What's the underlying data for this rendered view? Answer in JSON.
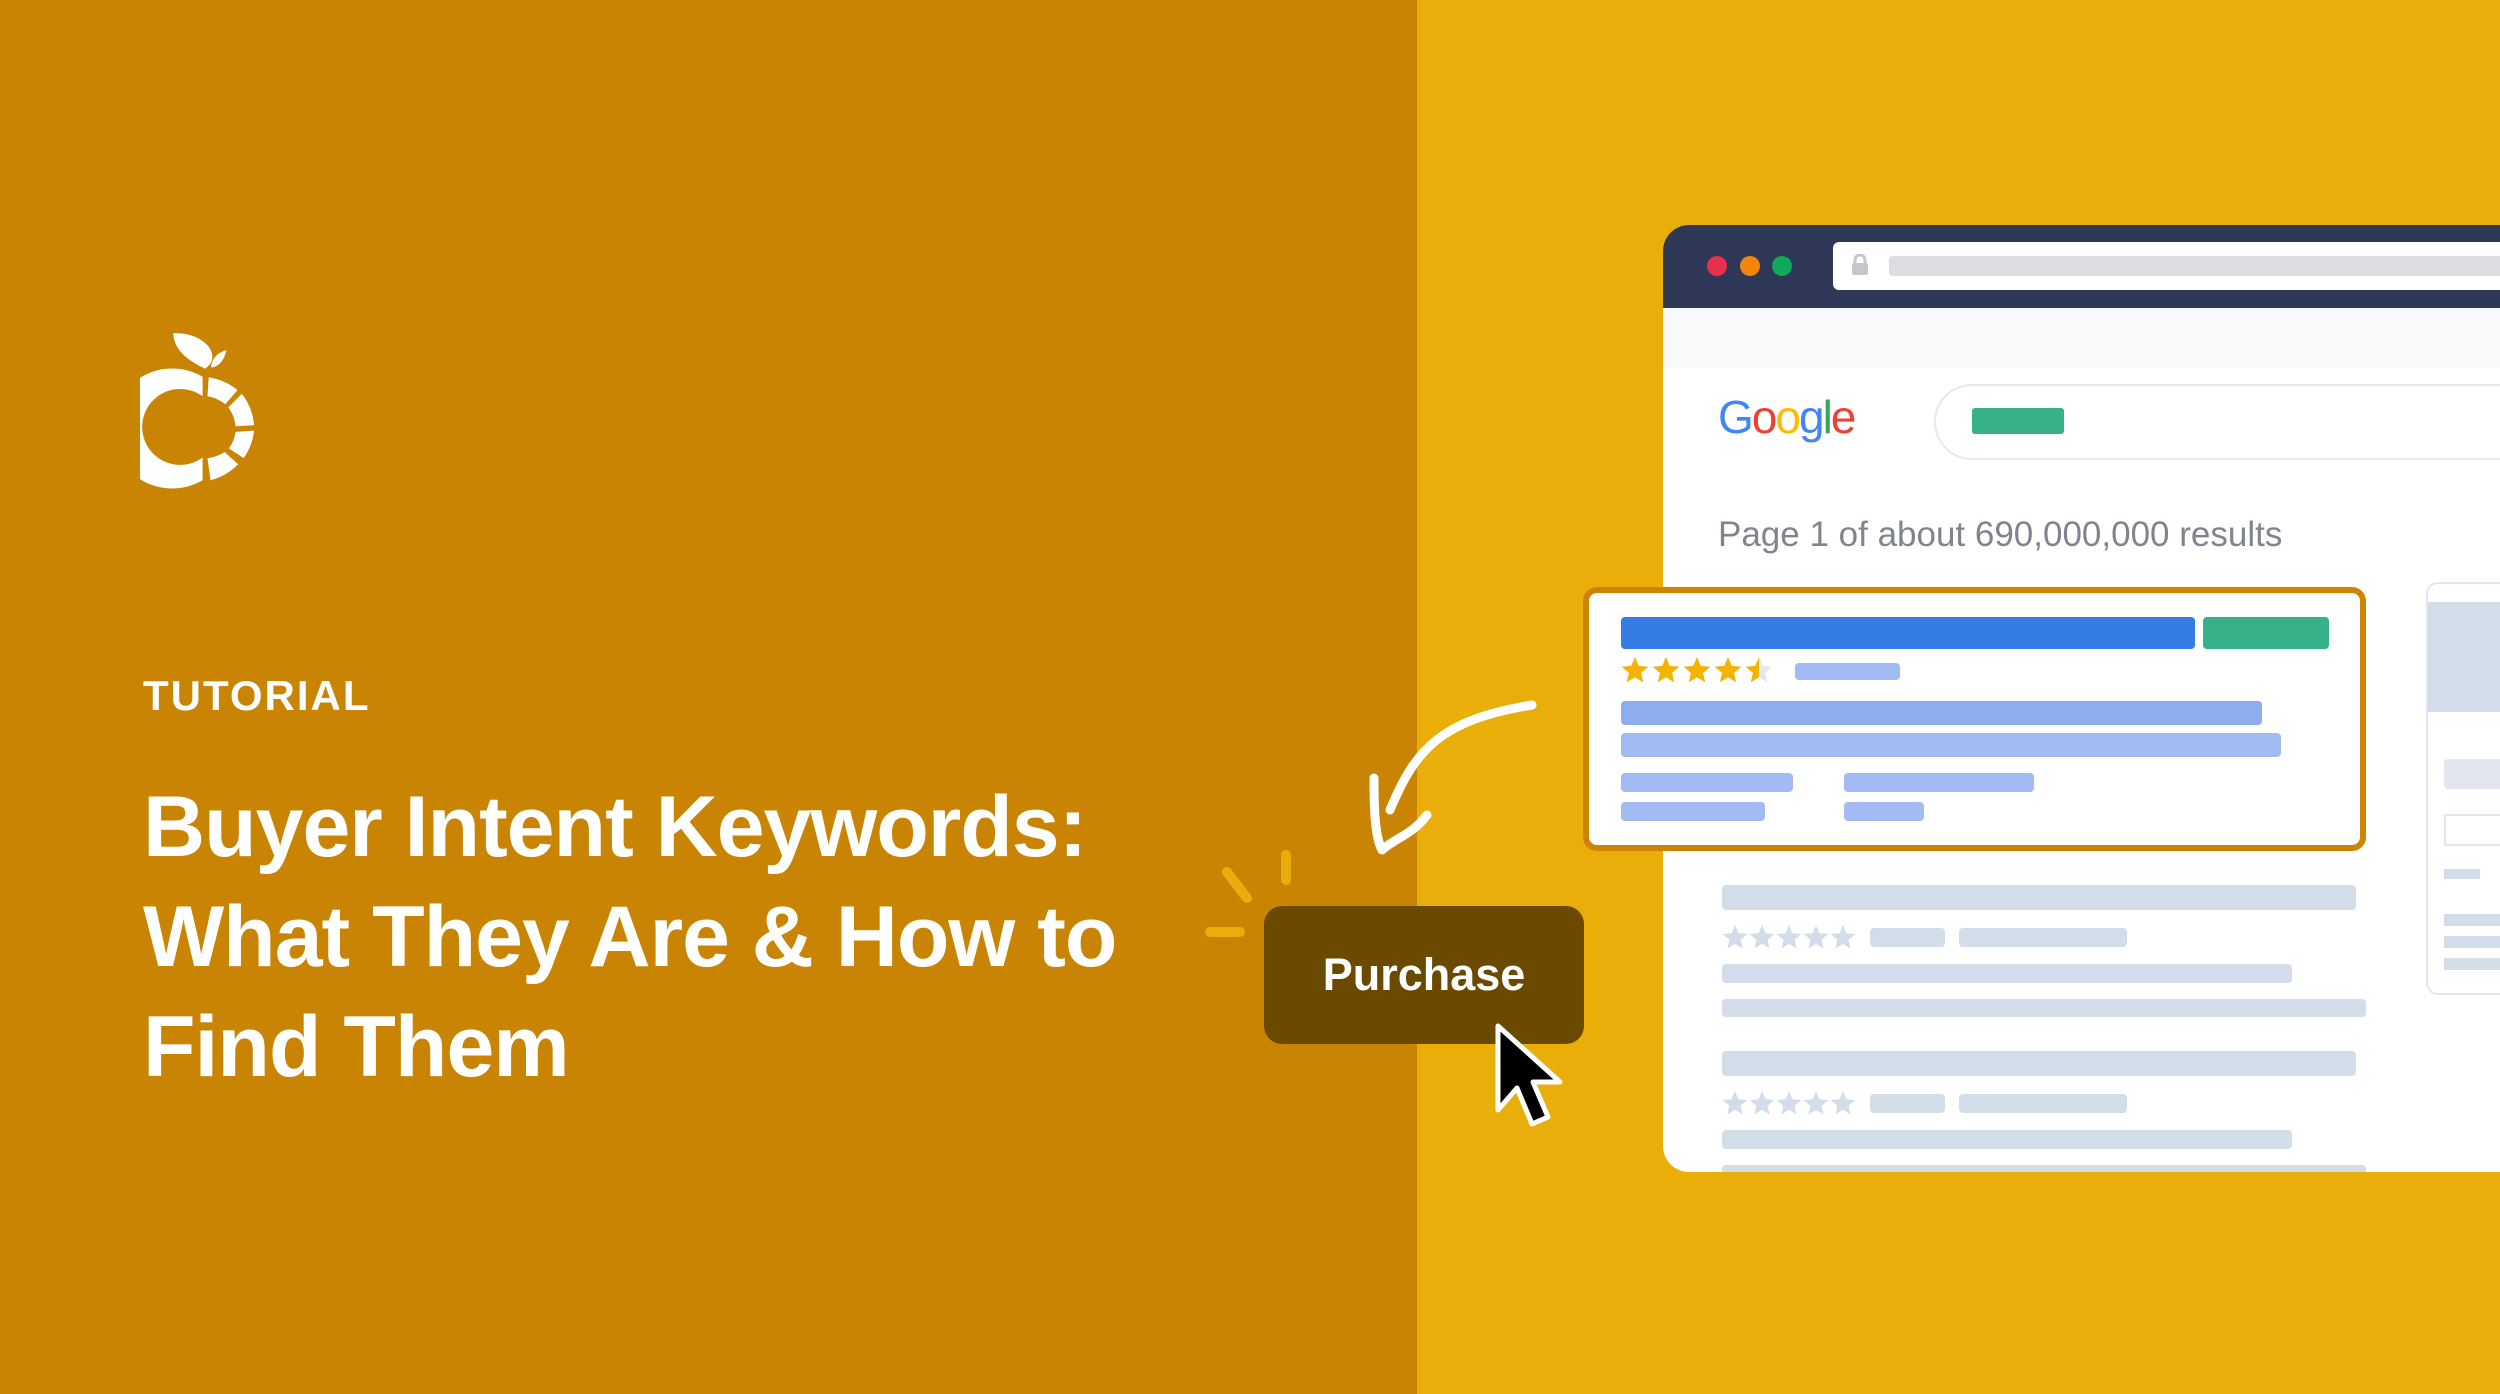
{
  "colors": {
    "left_bg": "#C98403",
    "right_bg": "#EAAE0A",
    "button_bg": "#6B4A00",
    "card_border": "#CC8503",
    "browser_bar": "#2F3756"
  },
  "hero": {
    "eyebrow": "TUTORIAL",
    "title_line1": "Buyer Intent Keywords:",
    "title_line2": "What They Are & How to",
    "title_line3": "Find Them"
  },
  "logo": {
    "icon": "orange-fruit-logo"
  },
  "browser": {
    "window_dots": [
      "#E8304A",
      "#F1860B",
      "#10A85A"
    ],
    "lock_icon": "lock-icon",
    "search_logo": [
      "G",
      "o",
      "o",
      "g",
      "l",
      "e"
    ],
    "search_logo_colors": [
      "#4285F4",
      "#EA4335",
      "#FBBC05",
      "#4285F4",
      "#34A853",
      "#EA4335"
    ],
    "results_text": "Page 1 of about 690,000,000 results",
    "featured_rating": 4.5
  },
  "cta": {
    "label": "Purchase",
    "icon": "mouse-pointer-icon"
  },
  "arrow": {
    "icon": "curved-arrow-icon"
  }
}
